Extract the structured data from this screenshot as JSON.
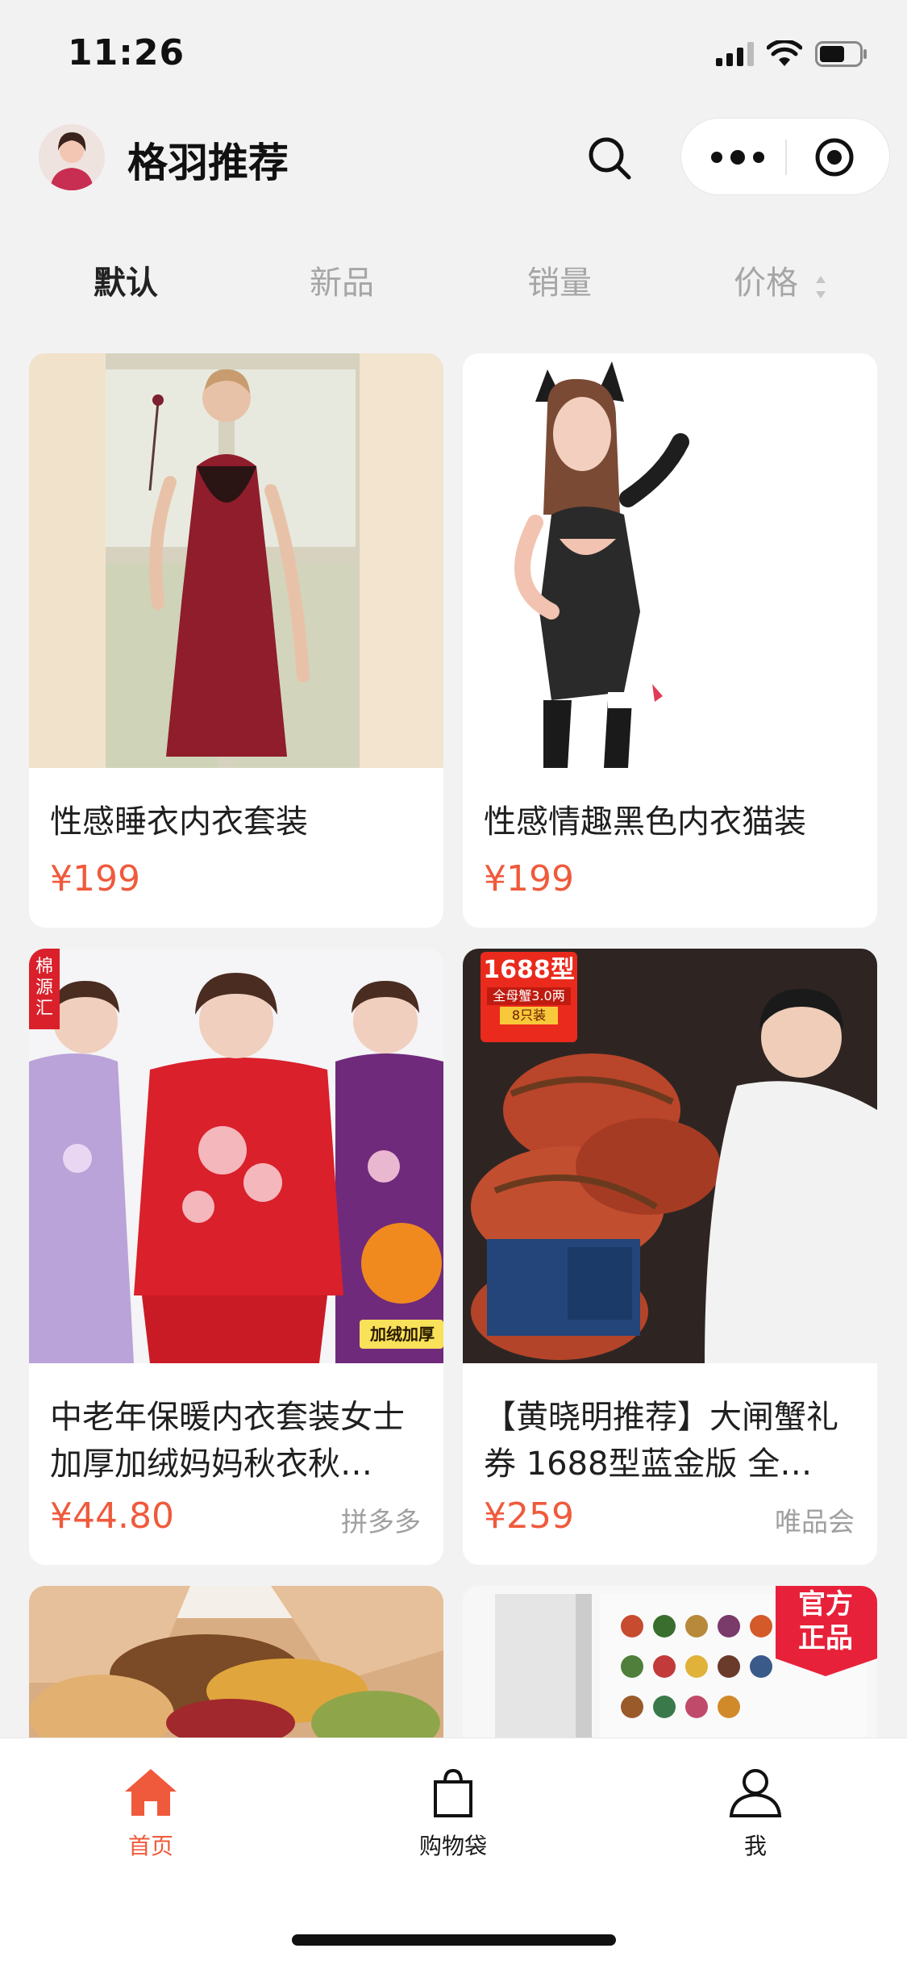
{
  "status": {
    "time": "11:26"
  },
  "header": {
    "title": "格羽推荐"
  },
  "sort_tabs": [
    {
      "label": "默认",
      "active": true
    },
    {
      "label": "新品",
      "active": false
    },
    {
      "label": "销量",
      "active": false
    },
    {
      "label": "价格",
      "active": false
    }
  ],
  "products": [
    {
      "name": "性感睡衣内衣套装",
      "price": "¥199",
      "source": ""
    },
    {
      "name": "性感情趣黑色内衣猫装",
      "price": "¥199",
      "source": ""
    },
    {
      "name": "中老年保暖内衣套装女士加厚加绒妈妈秋衣秋…",
      "price": "¥44.80",
      "source": "拼多多",
      "badge_text": "加绒加厚",
      "tag_text": "棉源汇"
    },
    {
      "name": "【黄晓明推荐】大闸蟹礼券 1688型蓝金版 全…",
      "price": "¥259",
      "source": "唯品会",
      "badge_title": "1688型",
      "badge_line1": "全母蟹3.0两",
      "badge_line2": "8只装"
    },
    {
      "name": "",
      "price": "",
      "source": ""
    },
    {
      "name": "",
      "price": "",
      "source": "",
      "ribbon_text": "官方正品"
    }
  ],
  "tabbar": [
    {
      "label": "首页",
      "icon": "home-icon",
      "active": true
    },
    {
      "label": "购物袋",
      "icon": "shopping-bag-icon",
      "active": false
    },
    {
      "label": "我",
      "icon": "user-icon",
      "active": false
    }
  ],
  "colors": {
    "accent": "#ef5a3c",
    "background": "#f2f2f2"
  }
}
